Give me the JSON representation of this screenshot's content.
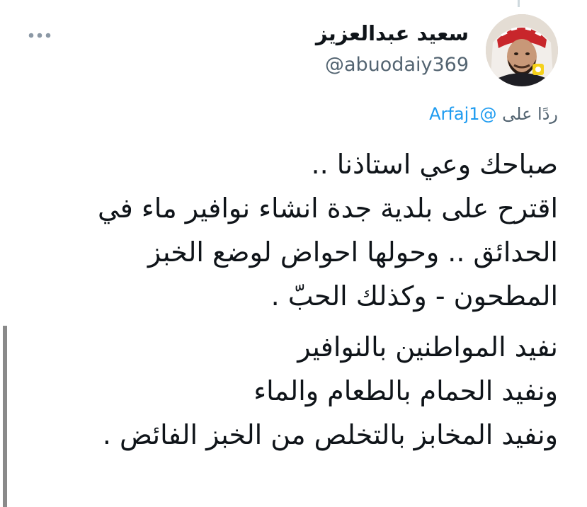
{
  "tweet": {
    "author": {
      "display_name": "سعيد عبدالعزيز",
      "handle": "@abuodaiy369",
      "avatar_icon": "profile-photo"
    },
    "more_icon": "more-horizontal-icon",
    "reply": {
      "prefix": "ردًا على",
      "mention": "@Arfaj1"
    },
    "paragraphs": [
      {
        "lines": [
          "صباحك وعي استاذنا ..",
          "اقترح على بلدية جدة انشاء نوافير ماء في",
          "الحدائق .. وحولها احواض لوضع الخبز",
          "المطحون - وكذلك الحبّ ."
        ]
      },
      {
        "lines": [
          "نفيد المواطنين بالنوافير",
          "ونفيد الحمام بالطعام والماء",
          "ونفيد المخابز بالتخلص من الخبز الفائض ."
        ]
      }
    ]
  },
  "colors": {
    "text": "#0f1419",
    "secondary": "#536471",
    "link": "#1d9bf0",
    "icon": "#8b98a5"
  }
}
